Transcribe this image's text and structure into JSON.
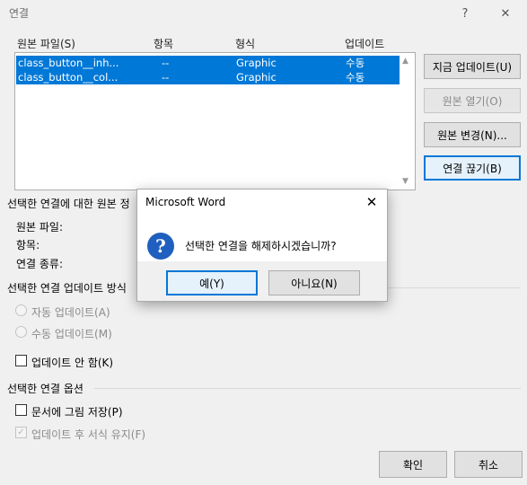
{
  "window": {
    "title": "연결",
    "help": "?",
    "close": "✕"
  },
  "links_table": {
    "headers": {
      "source": "원본 파일(S)",
      "item": "항목",
      "type": "형식",
      "update": "업데이트"
    },
    "rows": [
      {
        "source": "class_button__inh...",
        "item": "--",
        "type": "Graphic",
        "update": "수동"
      },
      {
        "source": "class_button__col...",
        "item": "--",
        "type": "Graphic",
        "update": "수동"
      }
    ]
  },
  "side_buttons": {
    "update_now": "지금 업데이트(U)",
    "open_source": "원본 열기(O)",
    "change_source": "원본 변경(N)...",
    "break_link": "연결 끊기(B)"
  },
  "info": {
    "section_title": "선택한 연결에 대한 원본 정",
    "source_file_label": "원본 파일:",
    "item_label": "항목:",
    "link_type_label": "연결 종류:"
  },
  "update_method": {
    "section_title": "선택한 연결 업데이트 방식",
    "auto": "자동 업데이트(A)",
    "manual": "수동 업데이트(M)",
    "locked": "업데이트 안 함(K)"
  },
  "options": {
    "section_title": "선택한 연결 옵션",
    "save_picture": "문서에 그림 저장(P)",
    "preserve_format": "업데이트 후 서식 유지(F)",
    "preserve_checked_glyph": "✓"
  },
  "bottom_buttons": {
    "ok": "확인",
    "cancel": "취소"
  },
  "message_box": {
    "title": "Microsoft Word",
    "close": "✕",
    "icon_glyph": "?",
    "text": "선택한 연결을 해제하시겠습니까?",
    "yes": "예(Y)",
    "no": "아니요(N)"
  },
  "colors": {
    "selection": "#0078d7",
    "accent_border": "#0078d7",
    "question_icon": "#1f5fbf"
  }
}
